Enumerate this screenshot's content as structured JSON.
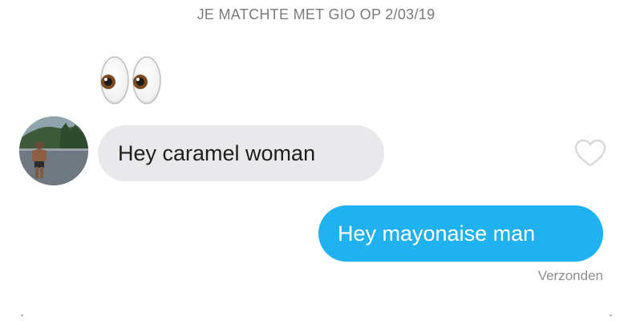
{
  "header": {
    "match_text": "JE MATCHTE MET GIO OP 2/03/19"
  },
  "messages": [
    {
      "direction": "received",
      "text": "Hey caramel woman",
      "liked": false
    },
    {
      "direction": "sent",
      "text": "Hey mayonaise man",
      "status": "Verzonden"
    }
  ],
  "icons": {
    "reaction": "eyes-emoji",
    "like": "heart-outline-icon"
  },
  "colors": {
    "background": "#ffffff",
    "received_bubble": "#e9e9eb",
    "sent_bubble": "#1fb1f0",
    "header_text": "#7b7b7b",
    "status_text": "#8e8e8e",
    "heart_outline": "#d9d9d9"
  }
}
